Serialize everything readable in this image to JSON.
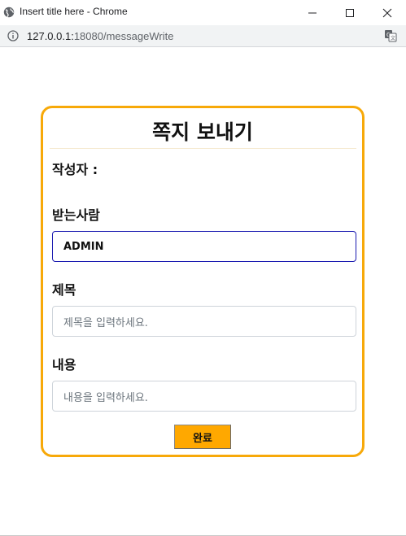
{
  "window": {
    "title": "Insert title here - Chrome",
    "icons": {
      "app": "globe-icon",
      "minimize": "minimize-icon",
      "maximize": "maximize-icon",
      "close": "close-icon"
    }
  },
  "addressbar": {
    "url_host": "127.0.0.1:",
    "url_rest": "18080/messageWrite",
    "icons": {
      "info": "info-icon",
      "translate": "translate-icon"
    }
  },
  "form": {
    "title": "쪽지 보내기",
    "writer_label": "작성자 :",
    "recipient_label": "받는사람",
    "recipient_value": "ADMIN",
    "subject_label": "제목",
    "subject_placeholder": "제목을 입력하세요.",
    "content_label": "내용",
    "content_placeholder": "내용을 입력하세요.",
    "submit_label": "완료"
  },
  "colors": {
    "card_border": "#f7a909",
    "submit_bg": "#ffa800",
    "active_input_border": "#1a1ab0"
  }
}
